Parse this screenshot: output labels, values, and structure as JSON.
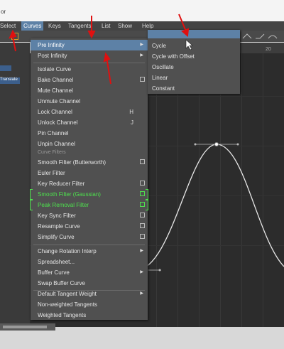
{
  "window": {
    "title": "or"
  },
  "menubar": {
    "items": [
      {
        "id": "select",
        "label": "Select"
      },
      {
        "id": "curves",
        "label": "Curves"
      },
      {
        "id": "keys",
        "label": "Keys"
      },
      {
        "id": "tangents",
        "label": "Tangents"
      },
      {
        "id": "list",
        "label": "List"
      },
      {
        "id": "show",
        "label": "Show"
      },
      {
        "id": "help",
        "label": "Help"
      }
    ],
    "active": "Curves"
  },
  "left_panel": {
    "selected_label": "Translate"
  },
  "ruler": {
    "ticks": [
      "20"
    ]
  },
  "curves_menu": {
    "items": [
      {
        "label": "Pre Infinity",
        "submenu": true,
        "highlight": true
      },
      {
        "label": "Post Infinity",
        "submenu": true
      },
      {
        "label": "Isolate Curve"
      },
      {
        "label": "Bake Channel",
        "option": true
      },
      {
        "label": "Mute Channel"
      },
      {
        "label": "Unmute Channel"
      },
      {
        "label": "Lock Channel",
        "shortcut": "H"
      },
      {
        "label": "Unlock Channel",
        "shortcut": "J"
      },
      {
        "label": "Pin Channel"
      },
      {
        "label": "Unpin Channel"
      },
      {
        "section": "Curve Filters"
      },
      {
        "label": "Smooth Filter (Butterworth)",
        "option": true
      },
      {
        "label": "Euler Filter"
      },
      {
        "label": "Key Reducer Filter",
        "option": true
      },
      {
        "label": "Smooth Filter (Gaussian)",
        "option": true,
        "green": true
      },
      {
        "label": "Peak Removal Filter",
        "option": true,
        "green": true
      },
      {
        "label": "Key Sync Filter",
        "option": true
      },
      {
        "label": "Resample Curve",
        "option": true
      },
      {
        "label": "Simplify Curve",
        "option": true
      },
      {
        "label": "Change Rotation Interp",
        "submenu": true
      },
      {
        "label": "Spreadsheet..."
      },
      {
        "label": "Buffer Curve",
        "submenu": true
      },
      {
        "label": "Swap Buffer Curve"
      },
      {
        "label": "Default Tangent Weight",
        "submenu": true
      },
      {
        "label": "Non-weighted Tangents"
      },
      {
        "label": "Weighted Tangents"
      }
    ]
  },
  "pre_infinity_submenu": {
    "items": [
      "Cycle",
      "Cycle with Offset",
      "Oscillate",
      "Linear",
      "Constant"
    ]
  },
  "colors": {
    "highlight": "#5d81a6",
    "menu_bg": "#505050",
    "graph_bg": "#2c2c2c",
    "green": "#4ee14e",
    "annotation": "#e01010"
  }
}
